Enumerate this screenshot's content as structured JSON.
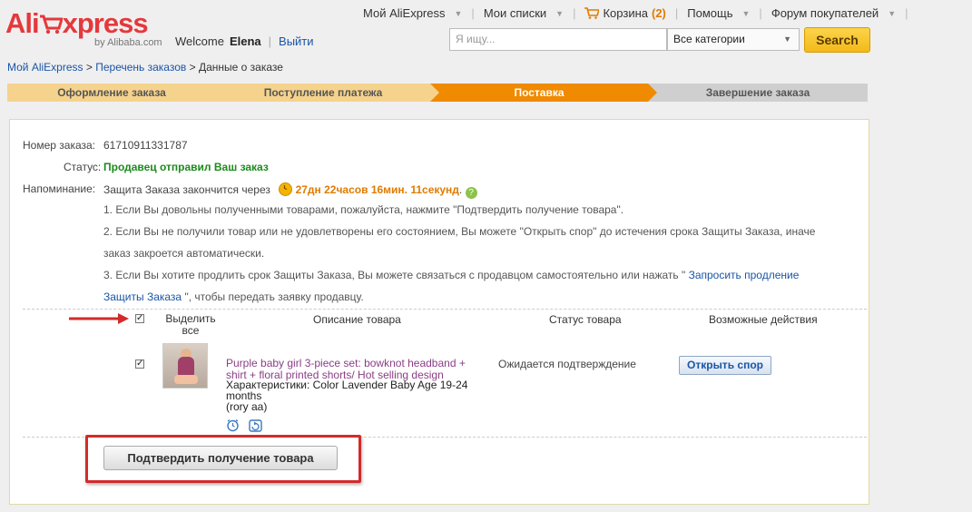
{
  "brand": {
    "logo_text_1": "Ali",
    "logo_text_2": "xpress",
    "logo_sub": "by Alibaba.com",
    "accent": "#e4393c"
  },
  "user": {
    "welcome": "Welcome",
    "name": "Elena",
    "logout": "Выйти"
  },
  "topnav": {
    "my_aliexpress": "Мой AliExpress",
    "my_lists": "Мои списки",
    "cart": "Корзина",
    "cart_count": "(2)",
    "help": "Помощь",
    "forum": "Форум покупателей"
  },
  "search": {
    "placeholder": "Я ищу...",
    "category": "Все категории",
    "button": "Search"
  },
  "breadcrumb": {
    "home": "Мой AliExpress",
    "orders": "Перечень заказов",
    "current": "Данные о заказе",
    "sep": ">"
  },
  "steps": [
    {
      "label": "Оформление заказа",
      "state": "done"
    },
    {
      "label": "Поступление платежа",
      "state": "done"
    },
    {
      "label": "Поставка",
      "state": "active"
    },
    {
      "label": "Завершение заказа",
      "state": "todo"
    }
  ],
  "order": {
    "number_label": "Номер заказа:",
    "number": "61710911331787",
    "status_label": "Статус:",
    "status": "Продавец отправил Ваш заказ",
    "reminder_label": "Напоминание:",
    "reminder_text": "Защита Заказа закончится через",
    "timer": "27дн 22часов 16мин. 11секунд",
    "timer_suffix": ".",
    "note1": "1. Если Вы довольны полученными товарами, пожалуйста, нажмите \"Подтвердить получение товара\".",
    "note2a": "2. Если Вы не получили товар или не удовлетворены его состоянием, Вы можете \"Открыть спор\" до истечения срока Защиты Заказа, иначе",
    "note2b": "заказ закроется автоматически.",
    "note3a": "3. Если Вы хотите продлить срок Защиты Заказа, Вы можете связаться с продавцом самостоятельно или нажать \"",
    "note3_link1": "Запросить продление",
    "note3_link2": "Защиты Заказа",
    "note3b": "\", чтобы передать заявку продавцу."
  },
  "table": {
    "select_all_1": "Выделить",
    "select_all_2": "все",
    "col_desc": "Описание товара",
    "col_status": "Статус товара",
    "col_actions": "Возможные действия"
  },
  "item": {
    "title": "Purple baby girl 3-piece set: bowknot headband + shirt + floral printed shorts/ Hot selling design",
    "attrs": "Характеристики: Color Lavender Baby Age 19-24 months",
    "seller": "(rory aa)",
    "status": "Ожидается подтверждение",
    "action": "Открыть спор"
  },
  "confirm_button": "Подтвердить получение товара"
}
